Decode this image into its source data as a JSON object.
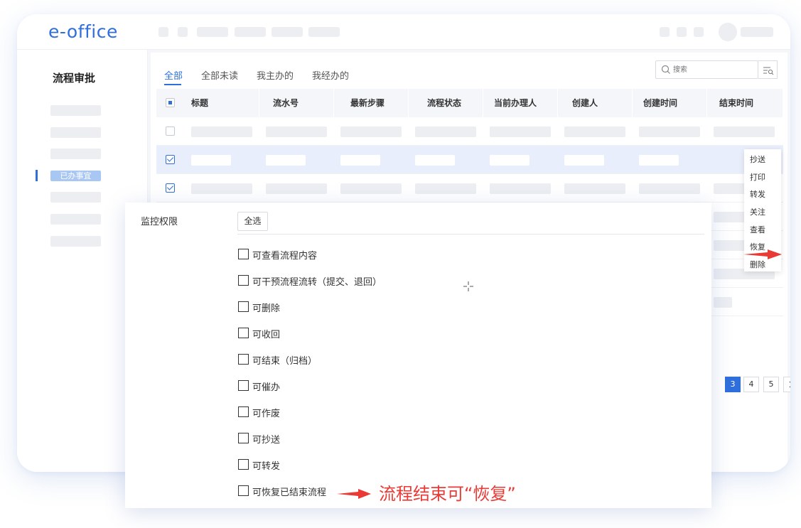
{
  "app": {
    "logo": "e-office"
  },
  "sidebar": {
    "title": "流程审批",
    "active_item": "已办事宜"
  },
  "tabs": [
    "全部",
    "全部未读",
    "我主办的",
    "我经办的"
  ],
  "search": {
    "placeholder": "搜索"
  },
  "table": {
    "columns": [
      "标题",
      "流水号",
      "最新步骤",
      "流程状态",
      "当前办理人",
      "创建人",
      "创建时间",
      "结束时间"
    ]
  },
  "context_menu": [
    "抄送",
    "打印",
    "转发",
    "关注",
    "查看",
    "恢复",
    "删除"
  ],
  "pagination": [
    "3",
    "4",
    "5"
  ],
  "dialog": {
    "label": "监控权限",
    "select_all": "全选",
    "options": [
      "可查看流程内容",
      "可干预流程流转（提交、退回）",
      "可删除",
      "可收回",
      "可结束（归档）",
      "可催办",
      "可作废",
      "可抄送",
      "可转发",
      "可恢复已结束流程"
    ]
  },
  "annotation": "流程结束可“恢复”",
  "colors": {
    "accent": "#2f6fdc",
    "annotation": "#ea3a35",
    "selected_row": "#e8eefb"
  }
}
